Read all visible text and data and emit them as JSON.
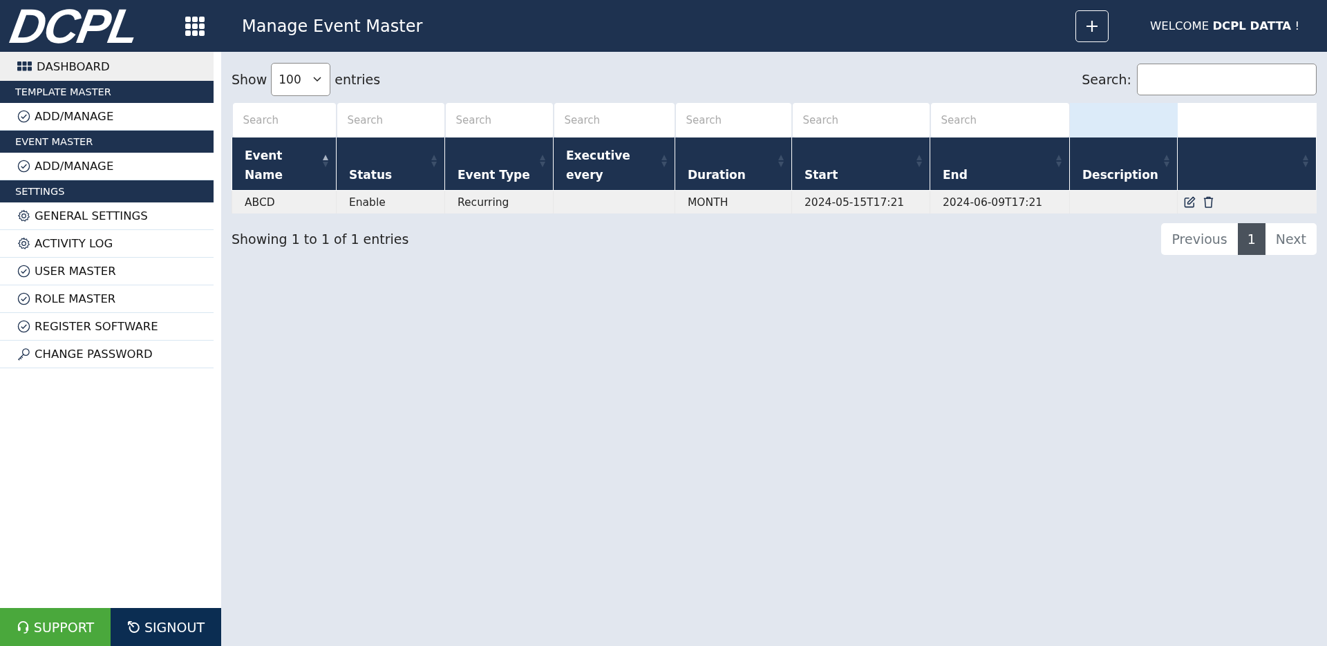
{
  "header": {
    "logo": "DCPL",
    "title": "Manage Event Master",
    "welcome": "WELCOME **DCPL DATTA** !"
  },
  "sidebar": {
    "items": [
      {
        "kind": "grid",
        "label": "DASHBOARD",
        "selected": true
      },
      {
        "kind": "section",
        "label": "TEMPLATE MASTER"
      },
      {
        "kind": "check",
        "label": "ADD/MANAGE",
        "selected": false
      },
      {
        "kind": "section",
        "label": "EVENT MASTER"
      },
      {
        "kind": "check",
        "label": "ADD/MANAGE",
        "selected": false
      },
      {
        "kind": "section",
        "label": "SETTINGS"
      },
      {
        "kind": "gear",
        "label": "GENERAL SETTINGS",
        "selected": false
      },
      {
        "kind": "gear",
        "label": "ACTIVITY LOG",
        "selected": false
      },
      {
        "kind": "check",
        "label": "USER MASTER",
        "selected": false
      },
      {
        "kind": "check",
        "label": "ROLE MASTER",
        "selected": false
      },
      {
        "kind": "check",
        "label": "REGISTER SOFTWARE",
        "selected": false
      },
      {
        "kind": "key",
        "label": "CHANGE PASSWORD",
        "selected": false
      }
    ],
    "support": "SUPPORT",
    "signout": "SIGNOUT"
  },
  "controls": {
    "show_label": "Show",
    "page_size": "100",
    "entries_label": "entries",
    "search_label": "Search:"
  },
  "table": {
    "filters": [
      {
        "kind": "search",
        "placeholder": "Search"
      },
      {
        "kind": "search",
        "placeholder": "Search"
      },
      {
        "kind": "search",
        "placeholder": "Search"
      },
      {
        "kind": "search",
        "placeholder": "Search"
      },
      {
        "kind": "search",
        "placeholder": "Search"
      },
      {
        "kind": "search",
        "placeholder": "Search"
      },
      {
        "kind": "search",
        "placeholder": "Search"
      },
      {
        "kind": "highlight"
      },
      {
        "kind": "blank"
      }
    ],
    "columns": [
      {
        "label": "Event Name",
        "selected": true
      },
      {
        "label": "Status",
        "selected": false
      },
      {
        "label": "Event Type",
        "selected": false
      },
      {
        "label": "Executive every",
        "selected": false
      },
      {
        "label": "Duration",
        "selected": false
      },
      {
        "label": "Start",
        "selected": false
      },
      {
        "label": "End",
        "selected": false
      },
      {
        "label": "Description",
        "selected": false
      },
      {
        "selected": false
      }
    ],
    "rows": [
      {
        "cells": [
          "ABCD",
          "Enable",
          "Recurring",
          "",
          "MONTH",
          "2024-05-15T17:21",
          "2024-06-09T17:21",
          ""
        ]
      }
    ]
  },
  "footer": {
    "info": "Showing 1 to 1 of 1 entries",
    "previous": {
      "label": "Previous",
      "disabled": true
    },
    "pages": [
      {
        "label": "1",
        "selected": true
      }
    ],
    "next": {
      "label": "Next",
      "disabled": true
    }
  }
}
